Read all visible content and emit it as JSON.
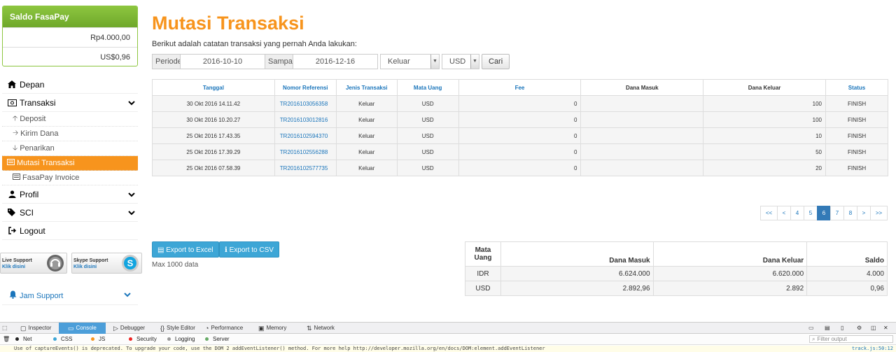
{
  "sidebar": {
    "saldo": {
      "title": "Saldo FasaPay",
      "idr": "Rp4.000,00",
      "usd": "US$0,96"
    },
    "menu": [
      {
        "label": "Depan",
        "icon": "home-icon"
      },
      {
        "label": "Transaksi",
        "icon": "money-icon",
        "expanded": true
      },
      {
        "label": "Profil",
        "icon": "user-icon"
      },
      {
        "label": "SCI",
        "icon": "tags-icon"
      },
      {
        "label": "Logout",
        "icon": "logout-icon"
      }
    ],
    "submenu": [
      {
        "label": "Deposit",
        "icon": "arrow-up-icon"
      },
      {
        "label": "Kirim Dana",
        "icon": "arrow-right-icon"
      },
      {
        "label": "Penarikan",
        "icon": "arrow-down-icon"
      },
      {
        "label": "Mutasi Transaksi",
        "icon": "list-icon",
        "active": true
      },
      {
        "label": "FasaPay Invoice",
        "icon": "list-icon"
      }
    ],
    "live_support": {
      "title": "Live Support",
      "link": "Klik disini"
    },
    "skype_support": {
      "title": "Skype Support",
      "link": "Klik disini"
    },
    "jam_support": "Jam Support"
  },
  "page": {
    "title": "Mutasi Transaksi",
    "subtitle": "Berikut adalah catatan transaksi yang pernah Anda lakukan:"
  },
  "filter": {
    "periode_label": "Periode",
    "periode_value": "2016-10-10",
    "sampai_label": "Sampai",
    "sampai_value": "2016-12-16",
    "type_value": "Keluar",
    "currency_value": "USD",
    "search_button": "Cari"
  },
  "table": {
    "headers": [
      "Tanggal",
      "Nomor Referensi",
      "Jenis Transaksi",
      "Mata Uang",
      "Fee",
      "Dana Masuk",
      "Dana Keluar",
      "Status"
    ],
    "rows": [
      [
        "30 Okt 2016 14.11.42",
        "TR2016103056358",
        "Keluar",
        "USD",
        "0",
        "",
        "100",
        "FINISH"
      ],
      [
        "30 Okt 2016 10.20.27",
        "TR2016103012816",
        "Keluar",
        "USD",
        "0",
        "",
        "100",
        "FINISH"
      ],
      [
        "25 Okt 2016 17.43.35",
        "TR2016102594370",
        "Keluar",
        "USD",
        "0",
        "",
        "10",
        "FINISH"
      ],
      [
        "25 Okt 2016 17.39.29",
        "TR2016102556288",
        "Keluar",
        "USD",
        "0",
        "",
        "50",
        "FINISH"
      ],
      [
        "25 Okt 2016 07.58.39",
        "TR2016102577735",
        "Keluar",
        "USD",
        "0",
        "",
        "20",
        "FINISH"
      ]
    ]
  },
  "pagination": [
    "<<",
    "<",
    "4",
    "5",
    "6",
    "7",
    "8",
    ">",
    ">>"
  ],
  "pagination_active": "6",
  "export": {
    "excel": "Export to Excel",
    "csv": "Export to CSV",
    "max": "Max 1000 data"
  },
  "summary": {
    "headers": [
      "Mata Uang",
      "Dana Masuk",
      "Dana Keluar",
      "Saldo"
    ],
    "rows": [
      [
        "IDR",
        "6.624.000",
        "6.620.000",
        "4.000"
      ],
      [
        "USD",
        "2.892,96",
        "2.892",
        "0,96"
      ]
    ]
  },
  "devtools": {
    "tabs": [
      "Inspector",
      "Console",
      "Debugger",
      "Style Editor",
      "Performance",
      "Memory",
      "Network"
    ],
    "active_tab": "Console",
    "filters": [
      "Net",
      "CSS",
      "JS",
      "Security",
      "Logging",
      "Server"
    ],
    "filter_output": "Filter output",
    "message": "Use of captureEvents() is deprecated. To upgrade your code, use the DOM 2 addEventListener() method. For more help http://developer.mozilla.org/en/docs/DOM:element.addEventListener",
    "message_source": "track.js:50:12"
  },
  "colors": {
    "accent": "#f7941d",
    "link": "#1a75bb",
    "saldo_green": "#8dc63f",
    "button_blue": "#3da6d6",
    "page_active": "#337ab7"
  }
}
